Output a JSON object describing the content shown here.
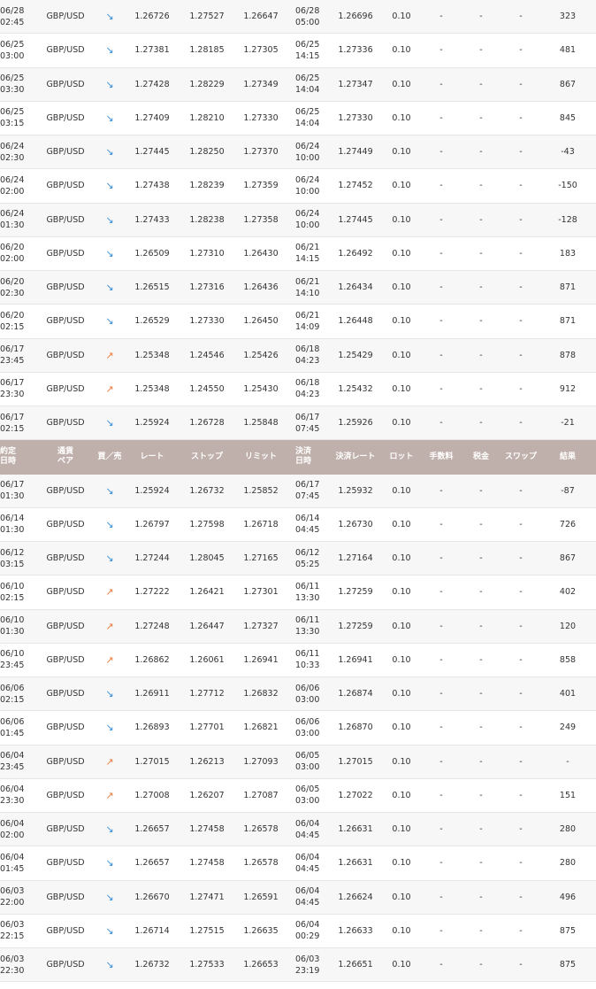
{
  "colors": {
    "header_bg": "#bfb0ab",
    "row_alt_bg": "#f7f7f7",
    "arrow_down": "#3a8fd9",
    "arrow_up": "#ee7a3c"
  },
  "header": {
    "order_date": "約定\n日時",
    "pair": "通貨\nペア",
    "side": "買／売",
    "rate": "レート",
    "stop": "ストップ",
    "limit": "リミット",
    "settle_date": "決済\n日時",
    "settle_rate": "決済レート",
    "lot": "ロット",
    "fee": "手数料",
    "tax": "税金",
    "swap": "スワップ",
    "result": "結果"
  },
  "trades_top": [
    {
      "date": "06/28\n02:45",
      "pair": "GBP/USD",
      "side": "↘",
      "side_type": "down",
      "rate": "1.26726",
      "stop": "1.27527",
      "limit": "1.26647",
      "settle_date": "06/28\n05:00",
      "settle_rate": "1.26696",
      "lot": "0.10",
      "fee": "-",
      "tax": "-",
      "swap": "-",
      "result": "323"
    },
    {
      "date": "06/25\n03:00",
      "pair": "GBP/USD",
      "side": "↘",
      "side_type": "down",
      "rate": "1.27381",
      "stop": "1.28185",
      "limit": "1.27305",
      "settle_date": "06/25\n14:15",
      "settle_rate": "1.27336",
      "lot": "0.10",
      "fee": "-",
      "tax": "-",
      "swap": "-",
      "result": "481"
    },
    {
      "date": "06/25\n03:30",
      "pair": "GBP/USD",
      "side": "↘",
      "side_type": "down",
      "rate": "1.27428",
      "stop": "1.28229",
      "limit": "1.27349",
      "settle_date": "06/25\n14:04",
      "settle_rate": "1.27347",
      "lot": "0.10",
      "fee": "-",
      "tax": "-",
      "swap": "-",
      "result": "867"
    },
    {
      "date": "06/25\n03:15",
      "pair": "GBP/USD",
      "side": "↘",
      "side_type": "down",
      "rate": "1.27409",
      "stop": "1.28210",
      "limit": "1.27330",
      "settle_date": "06/25\n14:04",
      "settle_rate": "1.27330",
      "lot": "0.10",
      "fee": "-",
      "tax": "-",
      "swap": "-",
      "result": "845"
    },
    {
      "date": "06/24\n02:30",
      "pair": "GBP/USD",
      "side": "↘",
      "side_type": "down",
      "rate": "1.27445",
      "stop": "1.28250",
      "limit": "1.27370",
      "settle_date": "06/24\n10:00",
      "settle_rate": "1.27449",
      "lot": "0.10",
      "fee": "-",
      "tax": "-",
      "swap": "-",
      "result": "-43"
    },
    {
      "date": "06/24\n02:00",
      "pair": "GBP/USD",
      "side": "↘",
      "side_type": "down",
      "rate": "1.27438",
      "stop": "1.28239",
      "limit": "1.27359",
      "settle_date": "06/24\n10:00",
      "settle_rate": "1.27452",
      "lot": "0.10",
      "fee": "-",
      "tax": "-",
      "swap": "-",
      "result": "-150"
    },
    {
      "date": "06/24\n01:30",
      "pair": "GBP/USD",
      "side": "↘",
      "side_type": "down",
      "rate": "1.27433",
      "stop": "1.28238",
      "limit": "1.27358",
      "settle_date": "06/24\n10:00",
      "settle_rate": "1.27445",
      "lot": "0.10",
      "fee": "-",
      "tax": "-",
      "swap": "-",
      "result": "-128"
    },
    {
      "date": "06/20\n02:00",
      "pair": "GBP/USD",
      "side": "↘",
      "side_type": "down",
      "rate": "1.26509",
      "stop": "1.27310",
      "limit": "1.26430",
      "settle_date": "06/21\n14:15",
      "settle_rate": "1.26492",
      "lot": "0.10",
      "fee": "-",
      "tax": "-",
      "swap": "-",
      "result": "183"
    },
    {
      "date": "06/20\n02:30",
      "pair": "GBP/USD",
      "side": "↘",
      "side_type": "down",
      "rate": "1.26515",
      "stop": "1.27316",
      "limit": "1.26436",
      "settle_date": "06/21\n14:10",
      "settle_rate": "1.26434",
      "lot": "0.10",
      "fee": "-",
      "tax": "-",
      "swap": "-",
      "result": "871"
    },
    {
      "date": "06/20\n02:15",
      "pair": "GBP/USD",
      "side": "↘",
      "side_type": "down",
      "rate": "1.26529",
      "stop": "1.27330",
      "limit": "1.26450",
      "settle_date": "06/21\n14:09",
      "settle_rate": "1.26448",
      "lot": "0.10",
      "fee": "-",
      "tax": "-",
      "swap": "-",
      "result": "871"
    },
    {
      "date": "06/17\n23:45",
      "pair": "GBP/USD",
      "side": "↗",
      "side_type": "up",
      "rate": "1.25348",
      "stop": "1.24546",
      "limit": "1.25426",
      "settle_date": "06/18\n04:23",
      "settle_rate": "1.25429",
      "lot": "0.10",
      "fee": "-",
      "tax": "-",
      "swap": "-",
      "result": "878"
    },
    {
      "date": "06/17\n23:30",
      "pair": "GBP/USD",
      "side": "↗",
      "side_type": "up",
      "rate": "1.25348",
      "stop": "1.24550",
      "limit": "1.25430",
      "settle_date": "06/18\n04:23",
      "settle_rate": "1.25432",
      "lot": "0.10",
      "fee": "-",
      "tax": "-",
      "swap": "-",
      "result": "912"
    },
    {
      "date": "06/17\n02:15",
      "pair": "GBP/USD",
      "side": "↘",
      "side_type": "down",
      "rate": "1.25924",
      "stop": "1.26728",
      "limit": "1.25848",
      "settle_date": "06/17\n07:45",
      "settle_rate": "1.25926",
      "lot": "0.10",
      "fee": "-",
      "tax": "-",
      "swap": "-",
      "result": "-21"
    }
  ],
  "trades_bottom": [
    {
      "date": "06/17\n01:30",
      "pair": "GBP/USD",
      "side": "↘",
      "side_type": "down",
      "rate": "1.25924",
      "stop": "1.26732",
      "limit": "1.25852",
      "settle_date": "06/17\n07:45",
      "settle_rate": "1.25932",
      "lot": "0.10",
      "fee": "-",
      "tax": "-",
      "swap": "-",
      "result": "-87"
    },
    {
      "date": "06/14\n01:30",
      "pair": "GBP/USD",
      "side": "↘",
      "side_type": "down",
      "rate": "1.26797",
      "stop": "1.27598",
      "limit": "1.26718",
      "settle_date": "06/14\n04:45",
      "settle_rate": "1.26730",
      "lot": "0.10",
      "fee": "-",
      "tax": "-",
      "swap": "-",
      "result": "726"
    },
    {
      "date": "06/12\n03:15",
      "pair": "GBP/USD",
      "side": "↘",
      "side_type": "down",
      "rate": "1.27244",
      "stop": "1.28045",
      "limit": "1.27165",
      "settle_date": "06/12\n05:25",
      "settle_rate": "1.27164",
      "lot": "0.10",
      "fee": "-",
      "tax": "-",
      "swap": "-",
      "result": "867"
    },
    {
      "date": "06/10\n02:15",
      "pair": "GBP/USD",
      "side": "↗",
      "side_type": "up",
      "rate": "1.27222",
      "stop": "1.26421",
      "limit": "1.27301",
      "settle_date": "06/11\n13:30",
      "settle_rate": "1.27259",
      "lot": "0.10",
      "fee": "-",
      "tax": "-",
      "swap": "-",
      "result": "402"
    },
    {
      "date": "06/10\n01:30",
      "pair": "GBP/USD",
      "side": "↗",
      "side_type": "up",
      "rate": "1.27248",
      "stop": "1.26447",
      "limit": "1.27327",
      "settle_date": "06/11\n13:30",
      "settle_rate": "1.27259",
      "lot": "0.10",
      "fee": "-",
      "tax": "-",
      "swap": "-",
      "result": "120"
    },
    {
      "date": "06/10\n23:45",
      "pair": "GBP/USD",
      "side": "↗",
      "side_type": "up",
      "rate": "1.26862",
      "stop": "1.26061",
      "limit": "1.26941",
      "settle_date": "06/11\n10:33",
      "settle_rate": "1.26941",
      "lot": "0.10",
      "fee": "-",
      "tax": "-",
      "swap": "-",
      "result": "858"
    },
    {
      "date": "06/06\n02:15",
      "pair": "GBP/USD",
      "side": "↘",
      "side_type": "down",
      "rate": "1.26911",
      "stop": "1.27712",
      "limit": "1.26832",
      "settle_date": "06/06\n03:00",
      "settle_rate": "1.26874",
      "lot": "0.10",
      "fee": "-",
      "tax": "-",
      "swap": "-",
      "result": "401"
    },
    {
      "date": "06/06\n01:45",
      "pair": "GBP/USD",
      "side": "↘",
      "side_type": "down",
      "rate": "1.26893",
      "stop": "1.27701",
      "limit": "1.26821",
      "settle_date": "06/06\n03:00",
      "settle_rate": "1.26870",
      "lot": "0.10",
      "fee": "-",
      "tax": "-",
      "swap": "-",
      "result": "249"
    },
    {
      "date": "06/04\n23:45",
      "pair": "GBP/USD",
      "side": "↗",
      "side_type": "up",
      "rate": "1.27015",
      "stop": "1.26213",
      "limit": "1.27093",
      "settle_date": "06/05\n03:00",
      "settle_rate": "1.27015",
      "lot": "0.10",
      "fee": "-",
      "tax": "-",
      "swap": "-",
      "result": "-"
    },
    {
      "date": "06/04\n23:30",
      "pair": "GBP/USD",
      "side": "↗",
      "side_type": "up",
      "rate": "1.27008",
      "stop": "1.26207",
      "limit": "1.27087",
      "settle_date": "06/05\n03:00",
      "settle_rate": "1.27022",
      "lot": "0.10",
      "fee": "-",
      "tax": "-",
      "swap": "-",
      "result": "151"
    },
    {
      "date": "06/04\n02:00",
      "pair": "GBP/USD",
      "side": "↘",
      "side_type": "down",
      "rate": "1.26657",
      "stop": "1.27458",
      "limit": "1.26578",
      "settle_date": "06/04\n04:45",
      "settle_rate": "1.26631",
      "lot": "0.10",
      "fee": "-",
      "tax": "-",
      "swap": "-",
      "result": "280"
    },
    {
      "date": "06/04\n01:45",
      "pair": "GBP/USD",
      "side": "↘",
      "side_type": "down",
      "rate": "1.26657",
      "stop": "1.27458",
      "limit": "1.26578",
      "settle_date": "06/04\n04:45",
      "settle_rate": "1.26631",
      "lot": "0.10",
      "fee": "-",
      "tax": "-",
      "swap": "-",
      "result": "280"
    },
    {
      "date": "06/03\n22:00",
      "pair": "GBP/USD",
      "side": "↘",
      "side_type": "down",
      "rate": "1.26670",
      "stop": "1.27471",
      "limit": "1.26591",
      "settle_date": "06/04\n04:45",
      "settle_rate": "1.26624",
      "lot": "0.10",
      "fee": "-",
      "tax": "-",
      "swap": "-",
      "result": "496"
    },
    {
      "date": "06/03\n22:15",
      "pair": "GBP/USD",
      "side": "↘",
      "side_type": "down",
      "rate": "1.26714",
      "stop": "1.27515",
      "limit": "1.26635",
      "settle_date": "06/04\n00:29",
      "settle_rate": "1.26633",
      "lot": "0.10",
      "fee": "-",
      "tax": "-",
      "swap": "-",
      "result": "875"
    },
    {
      "date": "06/03\n22:30",
      "pair": "GBP/USD",
      "side": "↘",
      "side_type": "down",
      "rate": "1.26732",
      "stop": "1.27533",
      "limit": "1.26653",
      "settle_date": "06/03\n23:19",
      "settle_rate": "1.26651",
      "lot": "0.10",
      "fee": "-",
      "tax": "-",
      "swap": "-",
      "result": "875"
    }
  ]
}
